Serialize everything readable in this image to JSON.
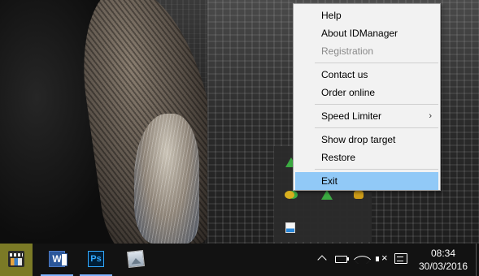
{
  "context_menu": {
    "items": [
      {
        "label": "Help",
        "enabled": true
      },
      {
        "label": "About IDManager",
        "enabled": true
      },
      {
        "label": "Registration",
        "enabled": false
      },
      {
        "label": "Contact us",
        "enabled": true
      },
      {
        "label": "Order online",
        "enabled": true
      },
      {
        "label": "Speed Limiter",
        "enabled": true,
        "submenu": true
      },
      {
        "label": "Show drop target",
        "enabled": true
      },
      {
        "label": "Restore",
        "enabled": true
      },
      {
        "label": "Exit",
        "enabled": true,
        "highlighted": true
      }
    ],
    "submenu_arrow": "›",
    "highlight_color": "#91c9f7",
    "disabled_color": "#8a8a8a"
  },
  "tray_overflow": {
    "icons": [
      "idm-icon",
      "colorful-app-icon",
      "idm-icon",
      "folder-badge-icon",
      "window-app-icon"
    ]
  },
  "taskbar": {
    "apps": [
      {
        "name": "film-app-icon",
        "active": true
      },
      {
        "name": "word-icon",
        "glyph": "W",
        "underline": true
      },
      {
        "name": "photoshop-icon",
        "glyph": "Ps",
        "underline": true
      },
      {
        "name": "photos-icon",
        "underline": false
      }
    ],
    "active_color": "#7b7a26",
    "underline_color": "#7fb3ff"
  },
  "system_tray": {
    "icons": [
      "chevron-up-icon",
      "battery-icon",
      "wifi-icon",
      "speaker-muted-icon",
      "action-center-icon"
    ],
    "time": "08:34",
    "date": "30/03/2016"
  }
}
